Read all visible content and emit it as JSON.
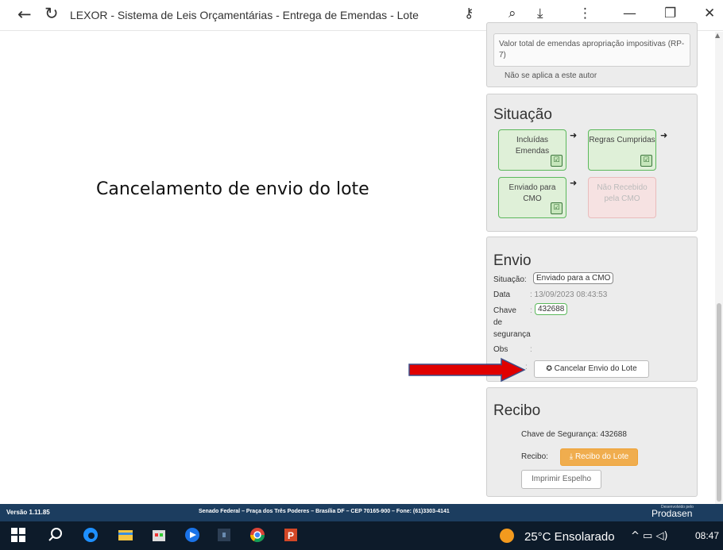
{
  "browser": {
    "title": "LEXOR - Sistema de Leis Orçamentárias - Entrega de Emendas - Lote",
    "back_icon": "←",
    "reload_icon": "↻",
    "key_icon": "⚷",
    "zoom_icon": "⌕",
    "download_icon": "⤓",
    "menu_icon": "⋮",
    "minimize_icon": "—",
    "restore_icon": "❐",
    "close_icon": "✕"
  },
  "heading": "Cancelamento de envio do lote",
  "valor_total": {
    "text": "Valor total de emendas apropriação impositivas (RP-7)",
    "note": "Não se aplica a este autor"
  },
  "situacao": {
    "title": "Situação",
    "steps": [
      {
        "label": "Incluídas Emendas",
        "done": true
      },
      {
        "label": "Regras Cumpridas",
        "done": true
      },
      {
        "label": "Enviado para CMO",
        "done": true
      },
      {
        "label": "Não Recebido pela CMO",
        "done": false
      }
    ],
    "check_glyph": "☑",
    "arrow_glyph": "➜"
  },
  "envio": {
    "title": "Envio",
    "situacao_label": "Situação:",
    "situacao_value": "Enviado para a CMO",
    "data_label": "Data",
    "data_value": ": 13/09/2023 08:43:53",
    "chave_label_1": "Chave",
    "chave_label_2": "de",
    "chave_label_3": "segurança",
    "chave_value": "432688",
    "obs_label": "Obs",
    "colon": ":",
    "cancel_icon": "✪",
    "cancel_button": "Cancelar Envio do Lote"
  },
  "recibo": {
    "title": "Recibo",
    "chave_label": "Chave de Segurança: 432688",
    "recibo_label": "Recibo:",
    "recibo_button": "⤓ Recibo do Lote",
    "espelho_button": "Imprimir Espelho"
  },
  "footer": {
    "version": "Versão 1.11.85",
    "address": "Senado Federal – Praça dos Três Poderes – Brasília DF – CEP 70165-900 – Fone: (61)3303-4141",
    "developed": "Desenvolvido pelo",
    "brand": "Prodasen"
  },
  "taskbar": {
    "weather": "25°C  Ensolarado",
    "tray": "^  ▭  ◁)",
    "time": "08:47"
  },
  "colors": {
    "success_bg": "#dff0d8",
    "success_border": "#5cb85c",
    "warning": "#f0ad4e",
    "footer": "#1c3d5f",
    "arrow_red": "#e00000"
  }
}
